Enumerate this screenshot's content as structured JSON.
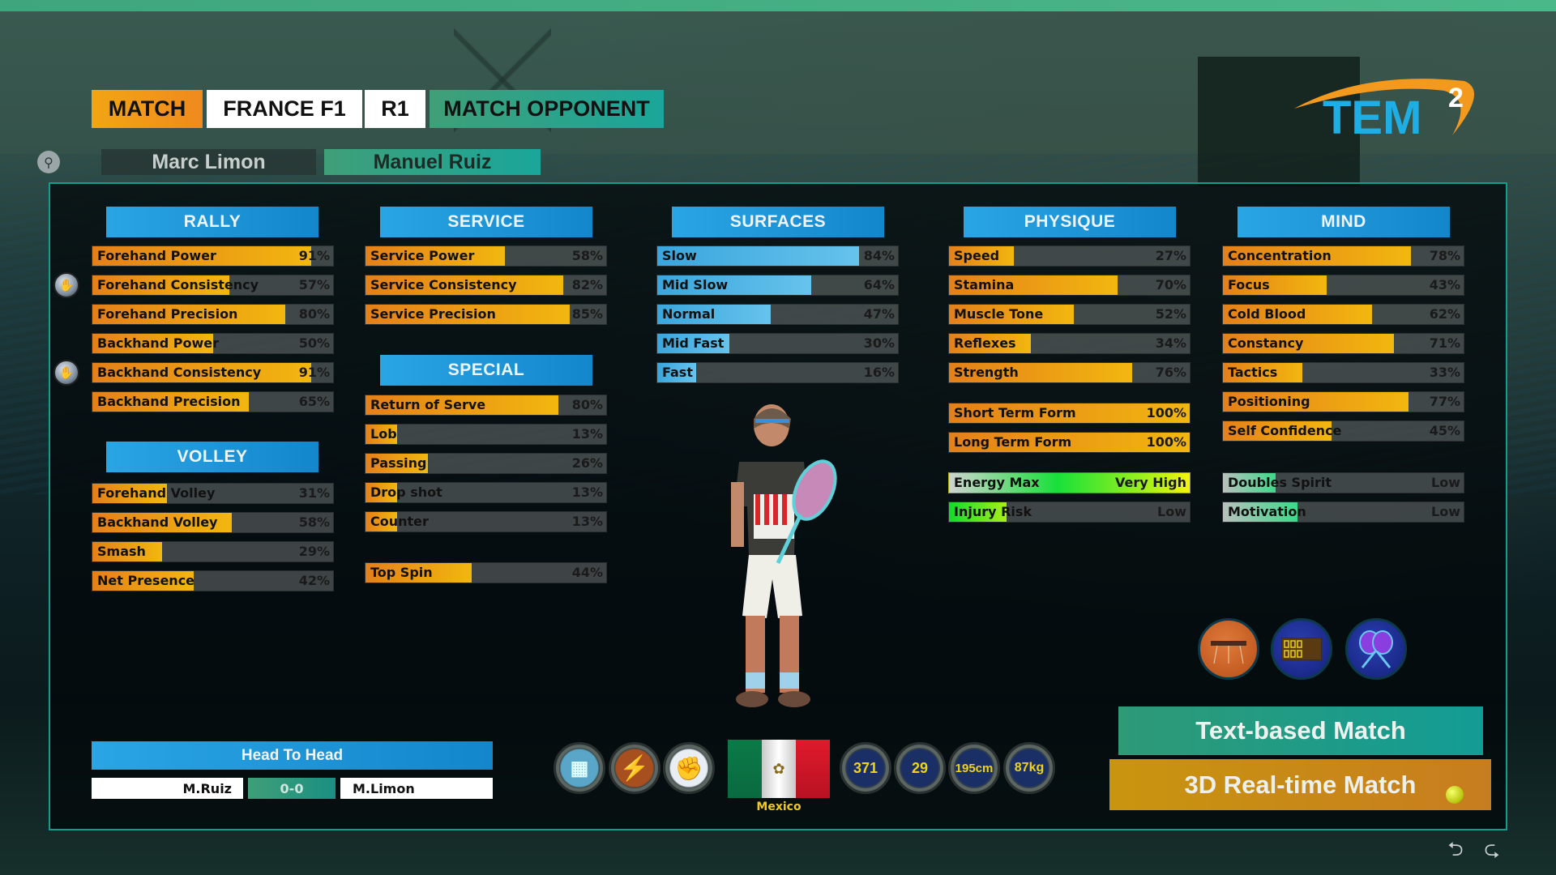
{
  "header": {
    "tabs": [
      {
        "label": "MATCH"
      },
      {
        "label": "FRANCE F1"
      },
      {
        "label": "R1"
      },
      {
        "label": "MATCH OPPONENT"
      }
    ],
    "players": {
      "left": "Marc Limon",
      "right": "Manuel Ruiz",
      "selected": "Manuel Ruiz"
    },
    "logo": {
      "text": "TEM",
      "superscript": "2"
    },
    "compare_icon": "rackets-compare-icon"
  },
  "sections": {
    "rally": {
      "title": "RALLY",
      "stats": [
        {
          "label": "Forehand Power",
          "value": 91,
          "display": "91%"
        },
        {
          "label": "Forehand Consistency",
          "value": 57,
          "display": "57%",
          "marker": "handshake-icon"
        },
        {
          "label": "Forehand Precision",
          "value": 80,
          "display": "80%"
        },
        {
          "label": "Backhand Power",
          "value": 50,
          "display": "50%"
        },
        {
          "label": "Backhand Consistency",
          "value": 91,
          "display": "91%",
          "marker": "handshake-icon"
        },
        {
          "label": "Backhand Precision",
          "value": 65,
          "display": "65%"
        }
      ]
    },
    "volley": {
      "title": "VOLLEY",
      "stats": [
        {
          "label": "Forehand Volley",
          "value": 31,
          "display": "31%"
        },
        {
          "label": "Backhand Volley",
          "value": 58,
          "display": "58%"
        },
        {
          "label": "Smash",
          "value": 29,
          "display": "29%"
        },
        {
          "label": "Net Presence",
          "value": 42,
          "display": "42%"
        }
      ]
    },
    "service": {
      "title": "SERVICE",
      "stats": [
        {
          "label": "Service Power",
          "value": 58,
          "display": "58%"
        },
        {
          "label": "Service Consistency",
          "value": 82,
          "display": "82%"
        },
        {
          "label": "Service Precision",
          "value": 85,
          "display": "85%"
        }
      ]
    },
    "special": {
      "title": "SPECIAL",
      "stats": [
        {
          "label": "Return of Serve",
          "value": 80,
          "display": "80%"
        },
        {
          "label": "Lob",
          "value": 13,
          "display": "13%"
        },
        {
          "label": "Passing",
          "value": 26,
          "display": "26%"
        },
        {
          "label": "Drop shot",
          "value": 13,
          "display": "13%"
        },
        {
          "label": "Counter",
          "value": 13,
          "display": "13%"
        }
      ],
      "extra": {
        "label": "Top Spin",
        "value": 44,
        "display": "44%"
      }
    },
    "surfaces": {
      "title": "SURFACES",
      "stats": [
        {
          "label": "Slow",
          "value": 84,
          "display": "84%"
        },
        {
          "label": "Mid Slow",
          "value": 64,
          "display": "64%"
        },
        {
          "label": "Normal",
          "value": 47,
          "display": "47%"
        },
        {
          "label": "Mid Fast",
          "value": 30,
          "display": "30%"
        },
        {
          "label": "Fast",
          "value": 16,
          "display": "16%"
        }
      ]
    },
    "physique": {
      "title": "PHYSIQUE",
      "stats": [
        {
          "label": "Speed",
          "value": 27,
          "display": "27%"
        },
        {
          "label": "Stamina",
          "value": 70,
          "display": "70%"
        },
        {
          "label": "Muscle Tone",
          "value": 52,
          "display": "52%"
        },
        {
          "label": "Reflexes",
          "value": 34,
          "display": "34%"
        },
        {
          "label": "Strength",
          "value": 76,
          "display": "76%"
        }
      ],
      "form": [
        {
          "label": "Short Term Form",
          "value": 100,
          "display": "100%"
        },
        {
          "label": "Long Term Form",
          "value": 100,
          "display": "100%"
        }
      ],
      "condition": [
        {
          "label": "Energy Max",
          "value": 100,
          "display": "Very High"
        },
        {
          "label": "Injury Risk",
          "value": 24,
          "display": "Low"
        }
      ]
    },
    "mind": {
      "title": "MIND",
      "stats": [
        {
          "label": "Concentration",
          "value": 78,
          "display": "78%"
        },
        {
          "label": "Focus",
          "value": 43,
          "display": "43%"
        },
        {
          "label": "Cold Blood",
          "value": 62,
          "display": "62%"
        },
        {
          "label": "Constancy",
          "value": 71,
          "display": "71%"
        },
        {
          "label": "Tactics",
          "value": 33,
          "display": "33%"
        },
        {
          "label": "Positioning",
          "value": 77,
          "display": "77%"
        },
        {
          "label": "Self Confidence",
          "value": 45,
          "display": "45%"
        }
      ],
      "traits": [
        {
          "label": "Doubles Spirit",
          "value": 22,
          "display": "Low"
        },
        {
          "label": "Motivation",
          "value": 31,
          "display": "Low"
        }
      ]
    }
  },
  "head_to_head": {
    "title": "Head To Head",
    "left": "M.Ruiz",
    "score": "0-0",
    "right": "M.Limon"
  },
  "profile": {
    "style_icons": [
      "net-player-icon",
      "lightning-icon",
      "fist-icon"
    ],
    "country": "Mexico",
    "ranking": "371",
    "age": "29",
    "height": "195cm",
    "weight": "87kg"
  },
  "options": {
    "surface_icon": "clay-court-icon",
    "score_icon": "scoreboard-icon",
    "racket_icon": "crossed-rackets-icon"
  },
  "actions": {
    "text_match": "Text-based Match",
    "realtime_match": "3D Real-time Match"
  },
  "nav": {
    "prev_icon": "back-arrow-icon",
    "next_icon": "forward-arrow-icon"
  },
  "colors": {
    "stat_bar": "#f2b70f",
    "surface_bar": "#66c3ec",
    "section_header": "#1f97d8",
    "accent_teal": "#129e8f"
  }
}
